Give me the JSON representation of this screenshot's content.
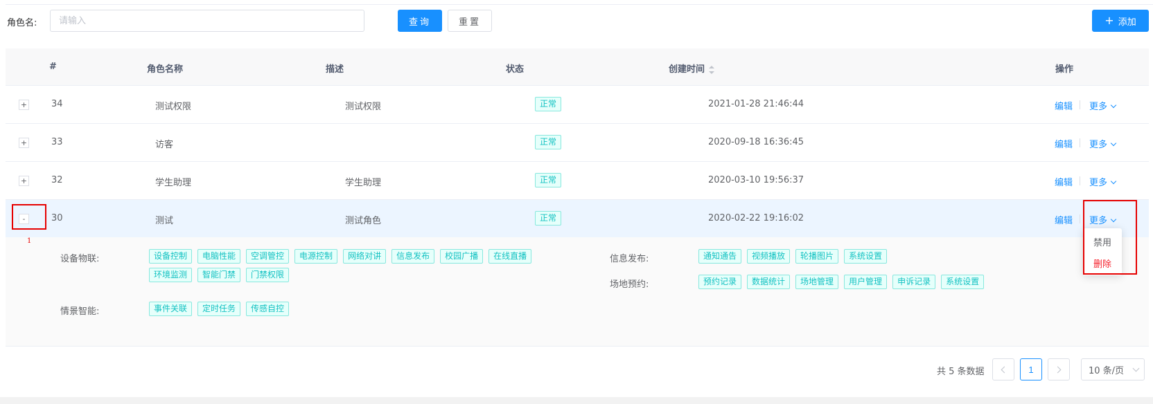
{
  "search": {
    "label": "角色名:",
    "placeholder": "请输入",
    "value": ""
  },
  "toolbar": {
    "search_label": "查询",
    "reset_label": "重置",
    "add_label": "添加"
  },
  "table": {
    "headers": {
      "id": "#",
      "name": "角色名称",
      "desc": "描述",
      "status": "状态",
      "created": "创建时间",
      "ops": "操作"
    },
    "rows": [
      {
        "toggle": "+",
        "id": "34",
        "name": "测试权限",
        "desc": "测试权限",
        "status": "正常",
        "created": "2021-01-28 21:46:44",
        "edit": "编辑",
        "more": "更多"
      },
      {
        "toggle": "+",
        "id": "33",
        "name": "访客",
        "desc": "",
        "status": "正常",
        "created": "2020-09-18 16:36:45",
        "edit": "编辑",
        "more": "更多"
      },
      {
        "toggle": "+",
        "id": "32",
        "name": "学生助理",
        "desc": "学生助理",
        "status": "正常",
        "created": "2020-03-10 19:56:37",
        "edit": "编辑",
        "more": "更多"
      },
      {
        "toggle": "-",
        "id": "30",
        "name": "测试",
        "desc": "测试角色",
        "status": "正常",
        "created": "2020-02-22 19:16:02",
        "edit": "编辑",
        "more": "更多"
      }
    ]
  },
  "expanded": {
    "groups": [
      {
        "label": "设备物联:",
        "tags": [
          "设备控制",
          "电脑性能",
          "空调管控",
          "电源控制",
          "网络对讲",
          "信息发布",
          "校园广播",
          "在线直播",
          "环境监测",
          "智能门禁",
          "门禁权限"
        ]
      },
      {
        "label": "情景智能:",
        "tags": [
          "事件关联",
          "定时任务",
          "传感自控"
        ]
      },
      {
        "label": "信息发布:",
        "tags": [
          "通知通告",
          "视频播放",
          "轮播图片",
          "系统设置"
        ]
      },
      {
        "label": "场地预约:",
        "tags": [
          "预约记录",
          "数据统计",
          "场地管理",
          "用户管理",
          "申诉记录",
          "系统设置"
        ]
      }
    ]
  },
  "dropdown": {
    "disable": "禁用",
    "delete": "删除"
  },
  "annotation": {
    "marker": "1"
  },
  "pagination": {
    "total": "共 5 条数据",
    "page": "1",
    "size": "10 条/页"
  },
  "colors": {
    "primary": "#1890ff",
    "tag_text": "#13c2c2",
    "tag_bg": "#e6fffb",
    "danger": "#f5222d",
    "annotation": "#e60000"
  }
}
